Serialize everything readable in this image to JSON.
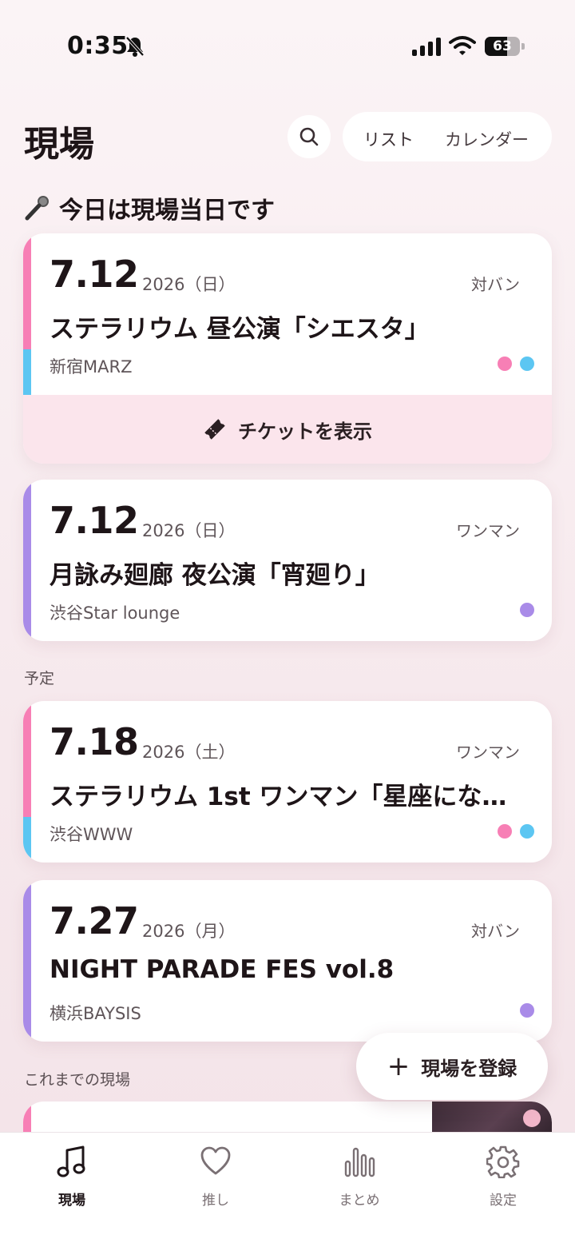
{
  "status_bar": {
    "time": "0:35",
    "battery": "63",
    "battery_level": 0.63
  },
  "header": {
    "title": "現場",
    "view_toggle": {
      "list": "リスト",
      "calendar": "カレンダー"
    }
  },
  "today_section": {
    "title": "今日は現場当日です"
  },
  "today_cards": [
    {
      "date": "7.12",
      "year": "2026（日）",
      "type": "対バン",
      "title": "ステラリウム 昼公演「シエスタ」",
      "venue": "新宿MARZ",
      "stripe_colors": [
        "#f77fb5",
        "#5cc6f2"
      ],
      "dot_colors": [
        "#f77fb5",
        "#5cc6f2"
      ],
      "ticket_label": "チケットを表示"
    },
    {
      "date": "7.12",
      "year": "2026（日）",
      "type": "ワンマン",
      "title": "月詠み廻廊 夜公演「宵廻り」",
      "venue": "渋谷Star lounge",
      "stripe_colors": [
        "#a98be8"
      ],
      "dot_colors": [
        "#a98be8"
      ]
    }
  ],
  "upcoming_section": {
    "title": "予定"
  },
  "upcoming_cards": [
    {
      "date": "7.18",
      "year": "2026（土）",
      "type": "ワンマン",
      "title": "ステラリウム 1st ワンマン「星座にな…",
      "venue": "渋谷WWW",
      "stripe_colors": [
        "#f77fb5",
        "#5cc6f2"
      ],
      "dot_colors": [
        "#f77fb5",
        "#5cc6f2"
      ]
    },
    {
      "date": "7.27",
      "year": "2026（月）",
      "type": "対バン",
      "title": "NIGHT PARADE FES vol.8",
      "venue": "横浜BAYSIS",
      "stripe_colors": [
        "#a98be8"
      ],
      "dot_colors": [
        "#a98be8"
      ]
    }
  ],
  "past_section": {
    "title": "これまでの現場"
  },
  "fab": {
    "plus": "+",
    "label": "現場を登録"
  },
  "tabbar": {
    "items": [
      {
        "label": "現場",
        "icon": "music-note-icon",
        "active": true
      },
      {
        "label": "推し",
        "icon": "heart-icon",
        "active": false
      },
      {
        "label": "まとめ",
        "icon": "bar-chart-icon",
        "active": false
      },
      {
        "label": "設定",
        "icon": "gear-icon",
        "active": false
      }
    ]
  }
}
